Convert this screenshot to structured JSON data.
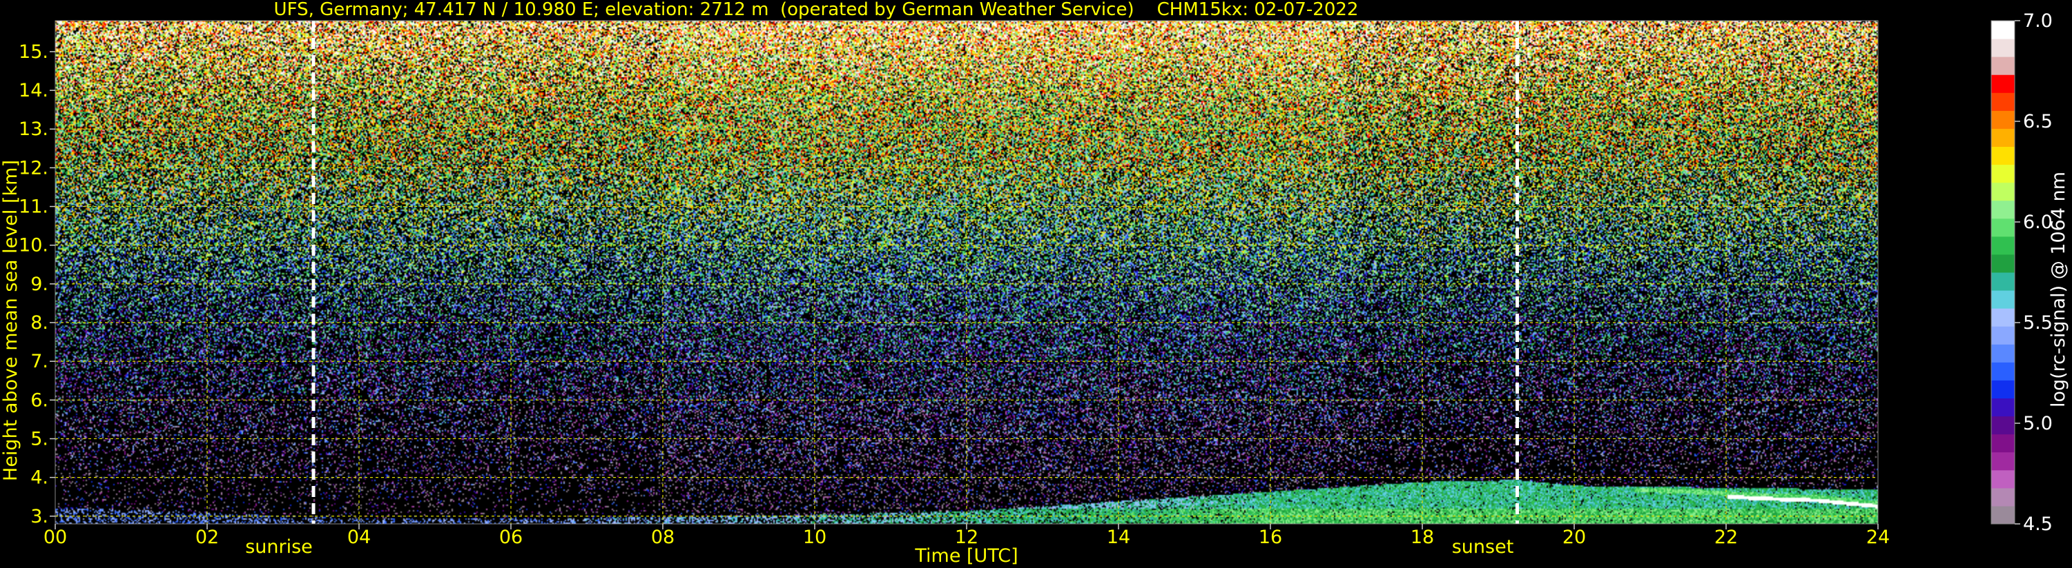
{
  "chart_data": {
    "type": "heatmap",
    "title": "UFS, Germany; 47.417 N / 10.980 E; elevation: 2712 m  (operated by German Weather Service)    CHM15kx: 02-07-2022",
    "xlabel": "Time [UTC]",
    "ylabel": "Height above mean sea level [km]",
    "xlim": [
      0,
      24
    ],
    "ylim": [
      2.8,
      15.8
    ],
    "x_ticks": [
      0,
      2,
      4,
      6,
      8,
      10,
      12,
      14,
      16,
      18,
      20,
      22,
      24
    ],
    "x_tick_labels": [
      "00",
      "02",
      "04",
      "06",
      "08",
      "10",
      "12",
      "14",
      "16",
      "18",
      "20",
      "22",
      "24"
    ],
    "y_ticks": [
      3,
      4,
      5,
      6,
      7,
      8,
      9,
      10,
      11,
      12,
      13,
      14,
      15
    ],
    "y_tick_labels": [
      "3.",
      "4.",
      "5.",
      "6.",
      "7.",
      "8.",
      "9.",
      "10.",
      "11.",
      "12.",
      "13.",
      "14.",
      "15."
    ],
    "grid": true,
    "markers": [
      {
        "label": "sunrise",
        "x": 3.4
      },
      {
        "label": "sunset",
        "x": 19.25
      }
    ],
    "colorbar": {
      "label": "log(rc-signal) @ 1064 nm",
      "range": [
        4.5,
        7.0
      ],
      "tick_labels": [
        "4.5",
        "5.0",
        "5.5",
        "6.0",
        "6.5",
        "7.0"
      ],
      "ticks": [
        4.5,
        5.0,
        5.5,
        6.0,
        6.5,
        7.0
      ]
    },
    "boundary_layer_top": [
      {
        "t": 0,
        "h": 3.25
      },
      {
        "t": 2,
        "h": 3.1
      },
      {
        "t": 4,
        "h": 2.95
      },
      {
        "t": 6,
        "h": 2.95
      },
      {
        "t": 8,
        "h": 3.0
      },
      {
        "t": 10,
        "h": 3.05
      },
      {
        "t": 12,
        "h": 3.15
      },
      {
        "t": 14,
        "h": 3.4
      },
      {
        "t": 16,
        "h": 3.65
      },
      {
        "t": 18,
        "h": 3.9
      },
      {
        "t": 19.25,
        "h": 3.95
      },
      {
        "t": 20,
        "h": 3.8
      },
      {
        "t": 22,
        "h": 3.75
      },
      {
        "t": 24,
        "h": 3.7
      }
    ],
    "cloud_layer": [
      {
        "t": 20.8,
        "h": 3.7
      },
      {
        "t": 21.5,
        "h": 3.65
      },
      {
        "t": 22.5,
        "h": 3.55
      },
      {
        "t": 23.2,
        "h": 3.5
      },
      {
        "t": 24,
        "h": 3.35
      }
    ]
  },
  "colors": {
    "text": "#ffff00",
    "grid": "#e0e000",
    "background": "#000000",
    "marker": "#ffffff",
    "colormap": [
      "#9a8a9a",
      "#b488b4",
      "#c060c0",
      "#a02aa0",
      "#80108a",
      "#5a0a90",
      "#3a10c0",
      "#1030f0",
      "#2a60ff",
      "#5a88ff",
      "#8aa8ff",
      "#a8c0ff",
      "#60d0e0",
      "#30b8a0",
      "#20a040",
      "#30c050",
      "#60e070",
      "#90f090",
      "#c0ff60",
      "#e8ff30",
      "#ffe000",
      "#ffb000",
      "#ff8000",
      "#ff4000",
      "#ff0000",
      "#e0b0b0",
      "#f0e0e0",
      "#ffffff"
    ]
  }
}
